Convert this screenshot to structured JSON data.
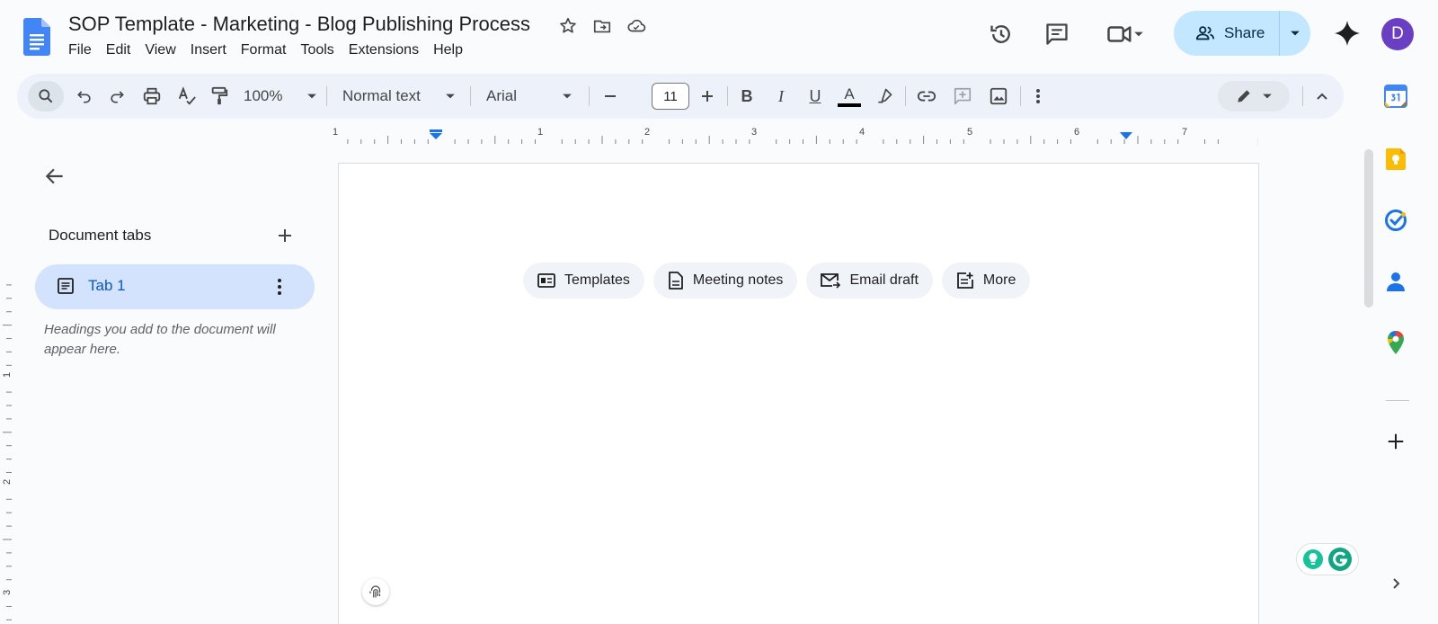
{
  "document": {
    "title": "SOP Template - Marketing - Blog Publishing Process"
  },
  "menu": [
    "File",
    "Edit",
    "View",
    "Insert",
    "Format",
    "Tools",
    "Extensions",
    "Help"
  ],
  "share": {
    "label": "Share"
  },
  "user": {
    "avatar_letter": "D",
    "avatar_color": "#6b3fc4"
  },
  "toolbar": {
    "zoom": "100%",
    "style": "Normal text",
    "font": "Arial",
    "font_size": "11",
    "bold": "B",
    "italic": "I",
    "underline": "U",
    "text_color_letter": "A"
  },
  "ruler": {
    "h_labels": [
      "1",
      "1",
      "2",
      "3",
      "4",
      "5",
      "6",
      "7"
    ],
    "v_labels": [
      "1",
      "2",
      "3"
    ]
  },
  "sidebar": {
    "section_title": "Document tabs",
    "tabs": [
      {
        "label": "Tab 1"
      }
    ],
    "hint": "Headings you add to the document will appear here."
  },
  "chips": [
    {
      "label": "Templates",
      "icon": "templates-icon"
    },
    {
      "label": "Meeting notes",
      "icon": "meeting-notes-icon"
    },
    {
      "label": "Email draft",
      "icon": "email-draft-icon"
    },
    {
      "label": "More",
      "icon": "more-building-blocks-icon"
    }
  ],
  "colors": {
    "accent": "#0b57d0",
    "share_bg": "#c2e7ff",
    "tab_active_bg": "#d3e3fd",
    "toolbar_bg": "#edf2fa",
    "chip_bg": "#f0f4f9"
  }
}
